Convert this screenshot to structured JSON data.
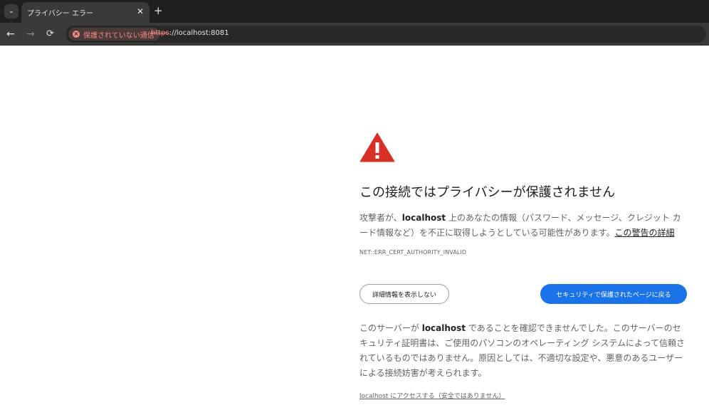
{
  "browser": {
    "tab_title": "プライバシー エラー",
    "tab_close": "✕",
    "new_tab": "+",
    "security_chip": "保護されていない通信",
    "url_scheme": "https",
    "url_rest": "://localhost:8081"
  },
  "page": {
    "heading": "この接続ではプライバシーが保護されません",
    "explanation_prefix": "攻撃者が、",
    "explanation_host": "localhost",
    "explanation_suffix": " 上のあなたの情報（パスワード、メッセージ、クレジット カード情報など）を不正に取得しようとしている可能性があります。",
    "learn_more": "この警告の詳細",
    "error_code": "NET::ERR_CERT_AUTHORITY_INVALID",
    "details_button": "詳細情報を表示しない",
    "primary_button": "セキュリティで保護されたページに戻る",
    "details_prefix": "このサーバーが ",
    "details_host": "localhost",
    "details_suffix": " であることを確認できませんでした。このサーバーのセキュリティ証明書は、ご使用のパソコンのオペレーティング システムによって信頼されているものではありません。原因としては、不適切な設定や、悪意のあるユーザーによる接続妨害が考えられます。",
    "proceed_link": "localhost にアクセスする（安全ではありません）"
  },
  "colors": {
    "warning": "#d93025",
    "primary": "#1a73e8",
    "insecure": "#f28b82"
  }
}
